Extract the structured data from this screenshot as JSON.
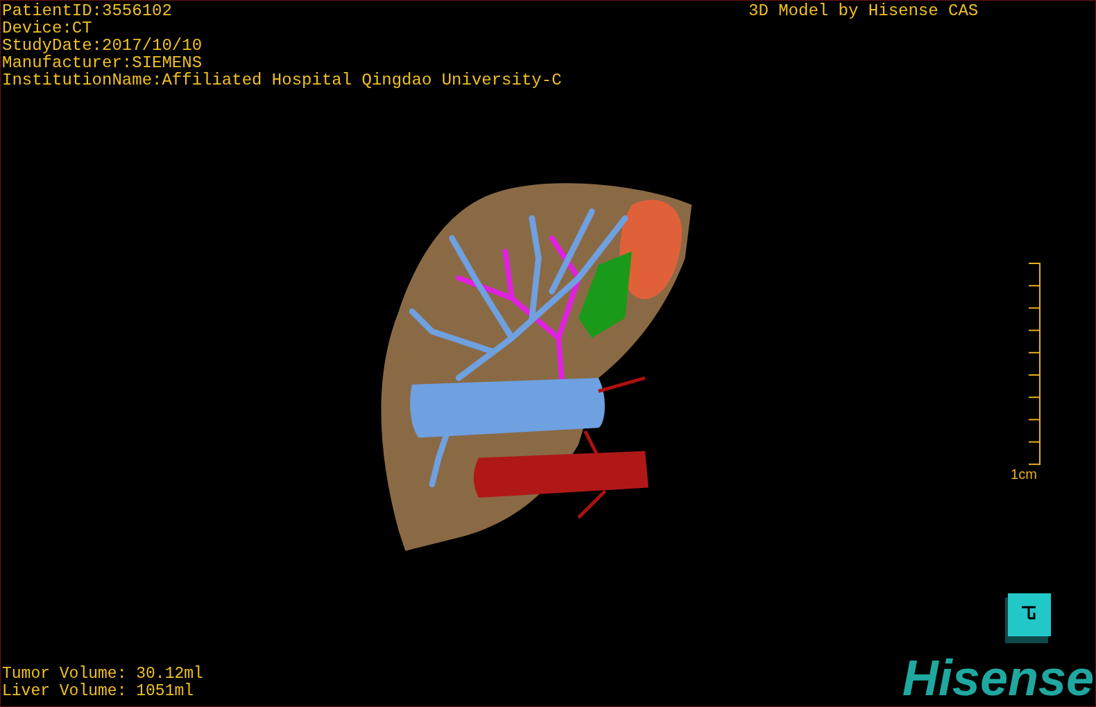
{
  "study_info": [
    "PatientID:3556102",
    "Device:CT",
    "StudyDate:2017/10/10",
    "Manufacturer:SIEMENS",
    "InstitutionName:Affiliated Hospital Qingdao University-C"
  ],
  "model_title": "3D Model by Hisense CAS",
  "scale_bar": {
    "label": "1cm"
  },
  "volumes": [
    "Tumor Volume: 30.12ml",
    "Liver Volume: 1051ml"
  ],
  "logo": "Hisense"
}
